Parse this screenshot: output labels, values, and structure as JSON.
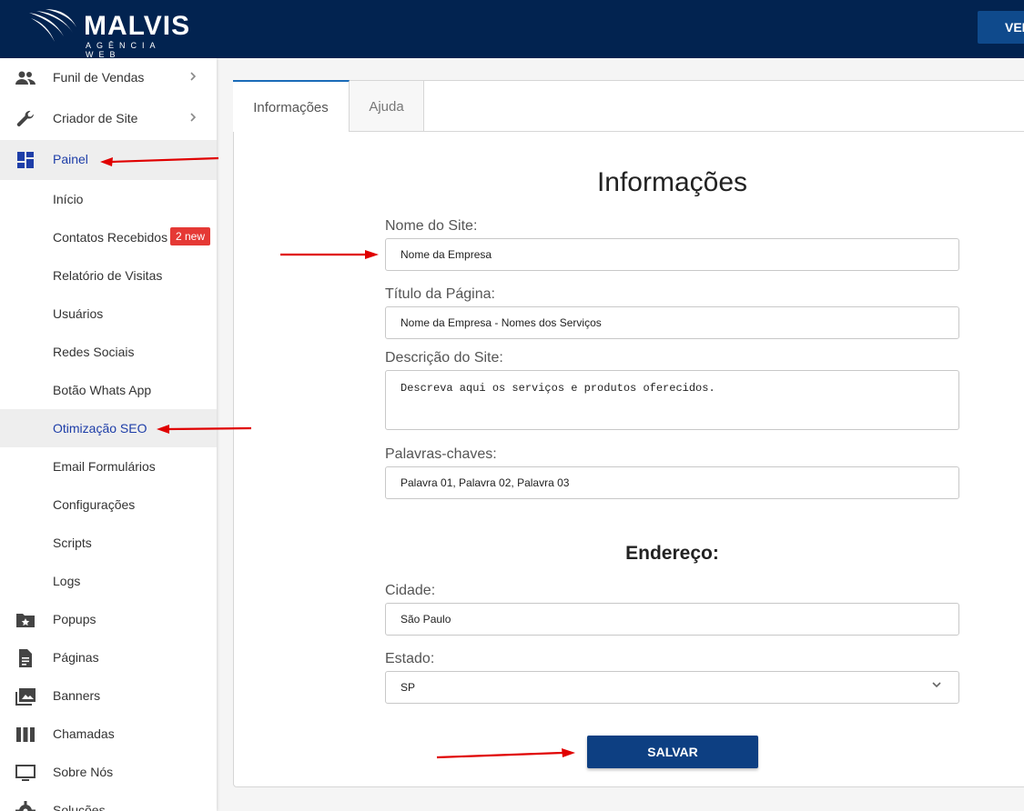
{
  "brand": {
    "name": "MALVIS",
    "tagline": "AGÊNCIA WEB"
  },
  "topbar": {
    "button_label": "VER"
  },
  "sidebar": {
    "items": [
      {
        "label": "Funil de Vendas",
        "icon": "people-icon"
      },
      {
        "label": "Criador de Site",
        "icon": "wrench-icon"
      },
      {
        "label": "Painel",
        "icon": "dashboard-icon"
      },
      {
        "label": "Início"
      },
      {
        "label": "Contatos Recebidos",
        "badge": "2 new"
      },
      {
        "label": "Relatório de Visitas"
      },
      {
        "label": "Usuários"
      },
      {
        "label": "Redes Sociais"
      },
      {
        "label": "Botão Whats App"
      },
      {
        "label": "Otimização SEO"
      },
      {
        "label": "Email Formulários"
      },
      {
        "label": "Configurações"
      },
      {
        "label": "Scripts"
      },
      {
        "label": "Logs"
      },
      {
        "label": "Popups",
        "icon": "folder-star-icon"
      },
      {
        "label": "Páginas",
        "icon": "document-icon"
      },
      {
        "label": "Banners",
        "icon": "images-icon"
      },
      {
        "label": "Chamadas",
        "icon": "columns-icon"
      },
      {
        "label": "Sobre Nós",
        "icon": "monitor-icon"
      },
      {
        "label": "Soluções",
        "icon": "gear-icon"
      }
    ]
  },
  "tabs": [
    {
      "label": "Informações"
    },
    {
      "label": "Ajuda"
    }
  ],
  "form": {
    "title": "Informações",
    "site_name": {
      "label": "Nome do Site:",
      "value": "Nome da Empresa"
    },
    "page_title": {
      "label": "Título da Página:",
      "value": "Nome da Empresa - Nomes dos Serviços"
    },
    "description": {
      "label": "Descrição do Site:",
      "value": "Descreva aqui os serviços e produtos oferecidos."
    },
    "keywords": {
      "label": "Palavras-chaves:",
      "value": "Palavra 01, Palavra 02, Palavra 03"
    },
    "address_title": "Endereço:",
    "city": {
      "label": "Cidade:",
      "value": "São Paulo"
    },
    "state": {
      "label": "Estado:",
      "value": "SP"
    },
    "save_label": "SALVAR"
  },
  "colors": {
    "topbar": "#022350",
    "accent": "#1e3ea8",
    "button": "#0d3f82",
    "annotation": "#e00000",
    "badge": "#e53935"
  }
}
